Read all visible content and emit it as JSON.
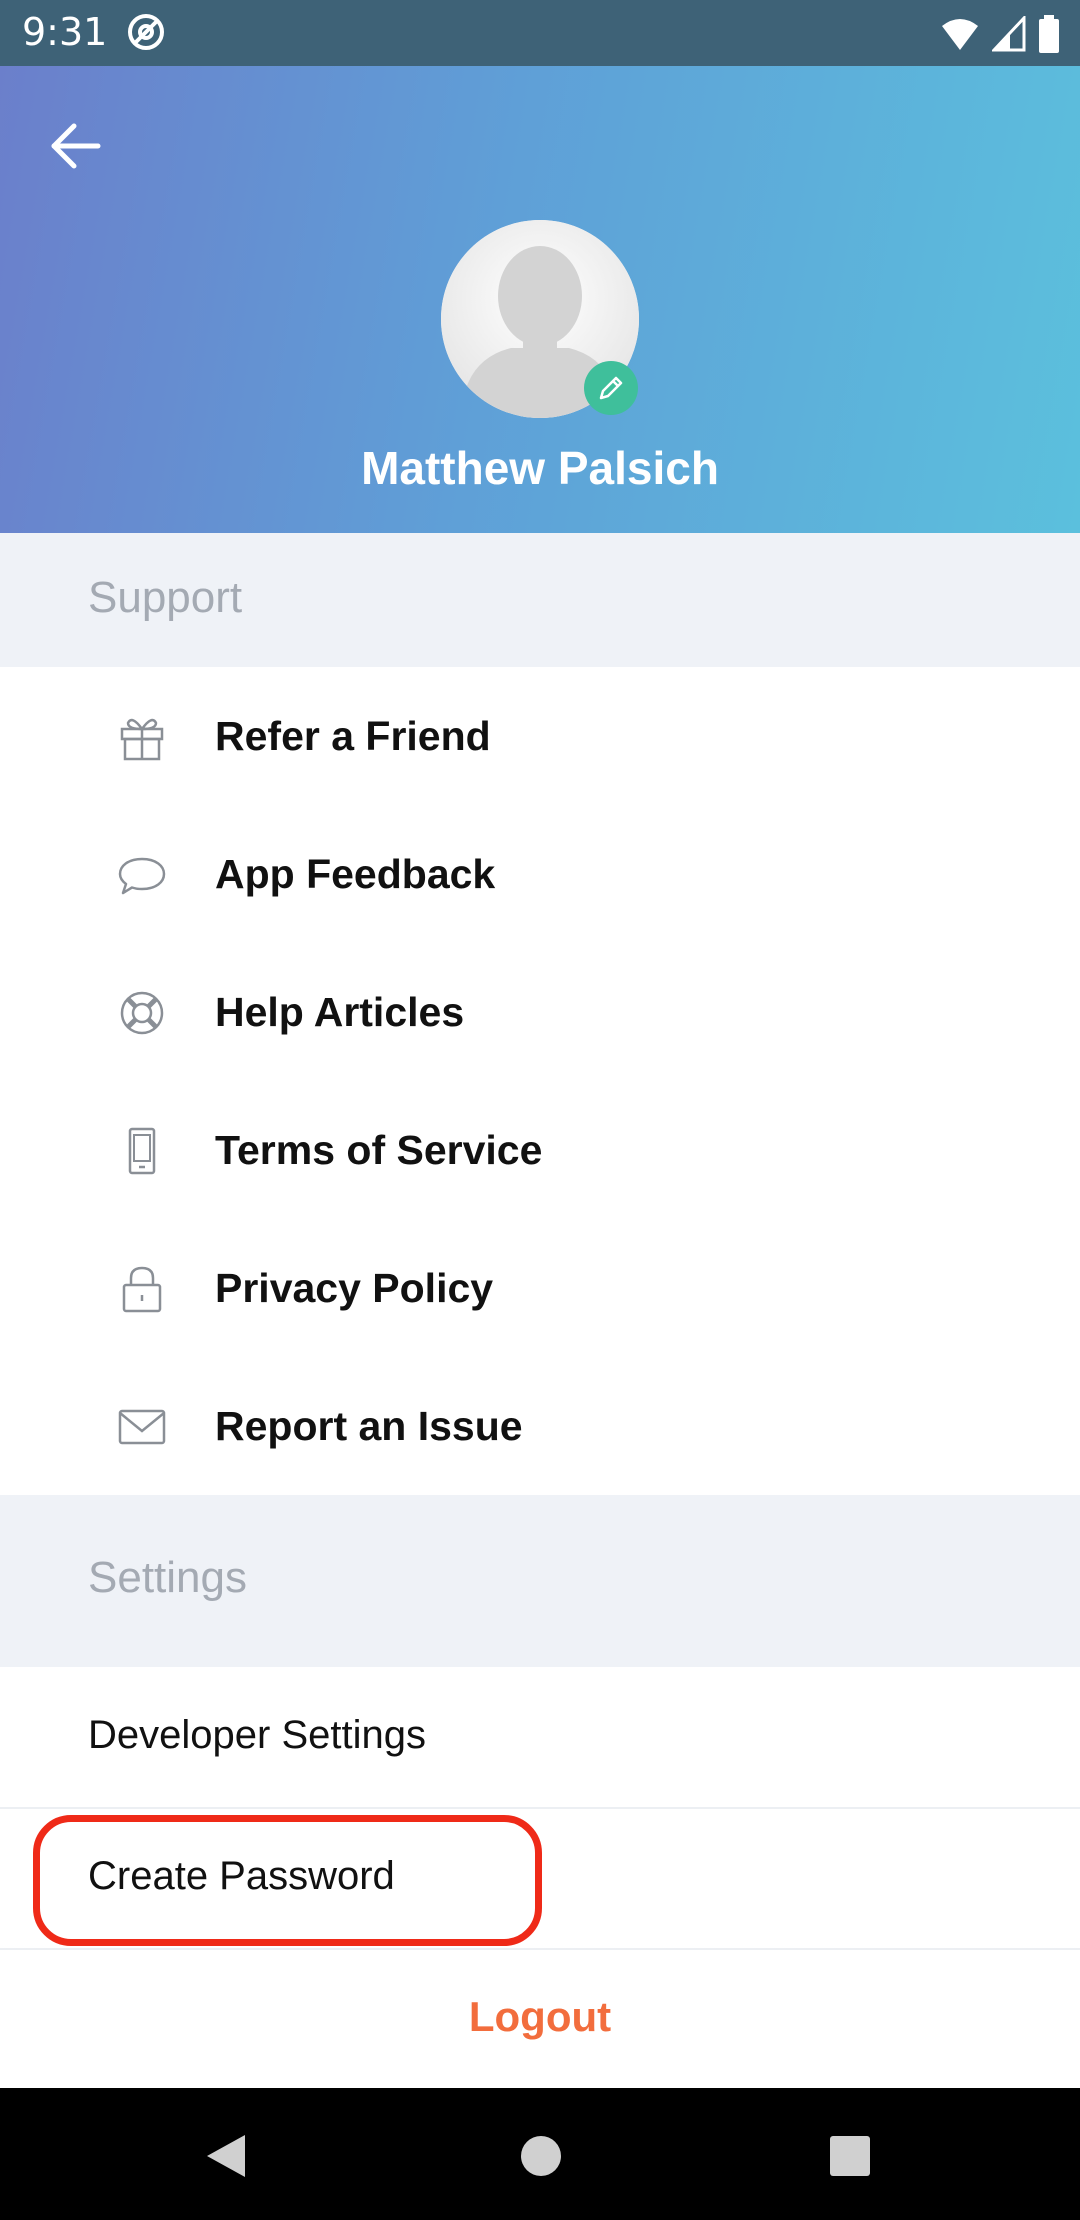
{
  "status_bar": {
    "time": "9:31"
  },
  "header": {
    "user_name": "Matthew Palsich"
  },
  "support": {
    "title": "Support",
    "items": [
      {
        "label": "Refer a Friend",
        "icon": "gift-icon"
      },
      {
        "label": "App Feedback",
        "icon": "chat-bubble-icon"
      },
      {
        "label": "Help Articles",
        "icon": "lifebuoy-icon"
      },
      {
        "label": "Terms of Service",
        "icon": "phone-document-icon"
      },
      {
        "label": "Privacy Policy",
        "icon": "lock-icon"
      },
      {
        "label": "Report an Issue",
        "icon": "envelope-icon"
      }
    ]
  },
  "settings": {
    "title": "Settings",
    "items": [
      {
        "label": "Developer Settings"
      },
      {
        "label": "Create Password"
      }
    ]
  },
  "logout_label": "Logout",
  "colors": {
    "accent_logout": "#f26d3d",
    "highlight": "#ef2a18",
    "edit_badge": "#3fbf9b",
    "section_bg": "#eff2f7"
  }
}
